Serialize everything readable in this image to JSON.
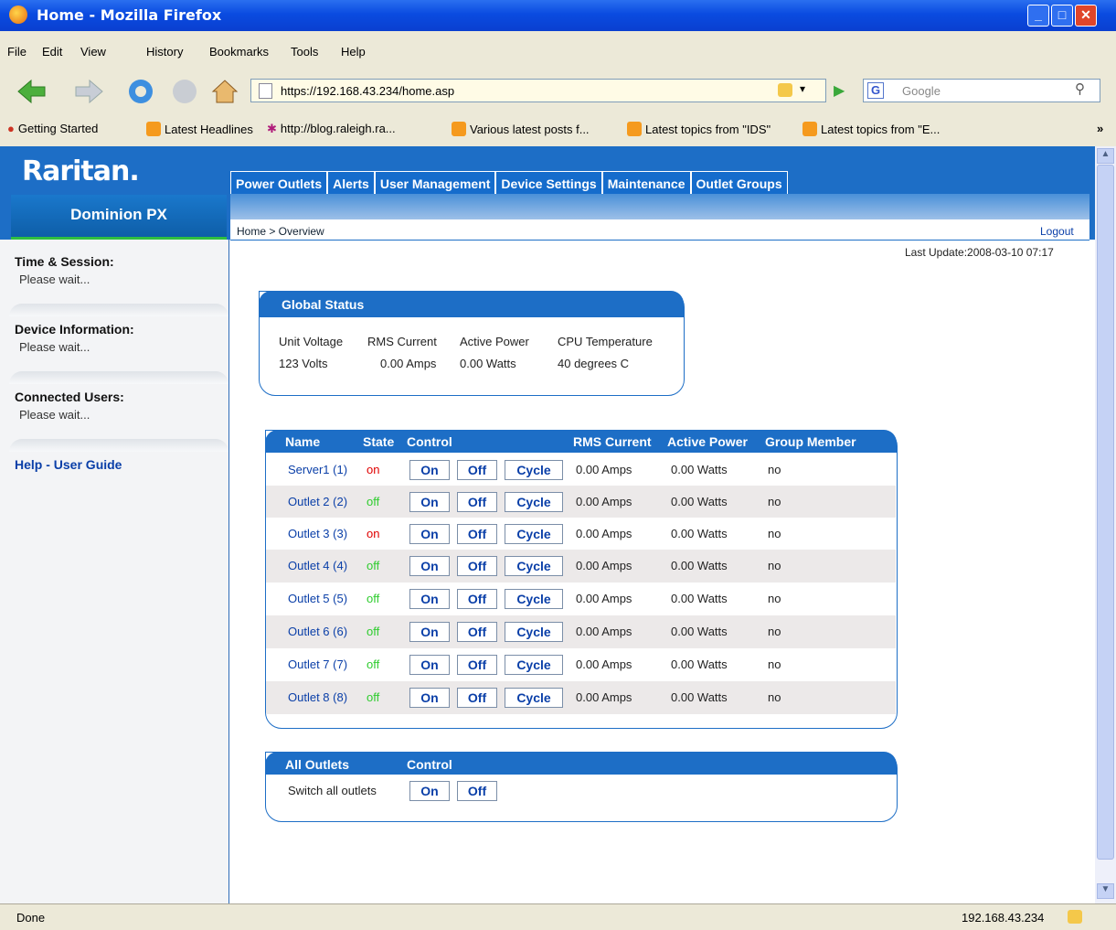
{
  "window": {
    "title": "Home - Mozilla Firefox"
  },
  "menu": [
    "File",
    "Edit",
    "View",
    "History",
    "Bookmarks",
    "Tools",
    "Help"
  ],
  "nav": {
    "url": "https://192.168.43.234/home.asp",
    "search_placeholder": "Google"
  },
  "bookmarks": [
    "Getting Started",
    "Latest Headlines",
    "http://blog.raleigh.ra...",
    "Various latest posts f...",
    "Latest topics from \"IDS\"",
    "Latest topics from \"E..."
  ],
  "header": {
    "logo": "Raritan.",
    "product": "Dominion PX",
    "tabs": [
      "Power Outlets",
      "Alerts",
      "User Management",
      "Device Settings",
      "Maintenance",
      "Outlet Groups"
    ],
    "breadcrumb": "Home > Overview",
    "logout": "Logout",
    "last_update": "Last Update:2008-03-10 07:17"
  },
  "sidebar": {
    "sections": [
      {
        "title": "Time & Session:",
        "value": "Please wait..."
      },
      {
        "title": "Device Information:",
        "value": "Please wait..."
      },
      {
        "title": "Connected Users:",
        "value": "Please wait..."
      }
    ],
    "help": "Help - User Guide"
  },
  "global_status": {
    "title": "Global Status",
    "labels": [
      "Unit Voltage",
      "RMS Current",
      "Active Power",
      "CPU Temperature"
    ],
    "values": [
      "123 Volts",
      "0.00 Amps",
      "0.00 Watts",
      "40 degrees C"
    ]
  },
  "outlets": {
    "headers": {
      "name": "Name",
      "state": "State",
      "control": "Control",
      "rms": "RMS Current",
      "power": "Active Power",
      "group": "Group Member"
    },
    "buttons": {
      "on": "On",
      "off": "Off",
      "cycle": "Cycle"
    },
    "rows": [
      {
        "name": "Server1 (1)",
        "state": "on",
        "rms": "0.00 Amps",
        "power": "0.00 Watts",
        "group": "no"
      },
      {
        "name": "Outlet 2 (2)",
        "state": "off",
        "rms": "0.00 Amps",
        "power": "0.00 Watts",
        "group": "no"
      },
      {
        "name": "Outlet 3 (3)",
        "state": "on",
        "rms": "0.00 Amps",
        "power": "0.00 Watts",
        "group": "no"
      },
      {
        "name": "Outlet 4 (4)",
        "state": "off",
        "rms": "0.00 Amps",
        "power": "0.00 Watts",
        "group": "no"
      },
      {
        "name": "Outlet 5 (5)",
        "state": "off",
        "rms": "0.00 Amps",
        "power": "0.00 Watts",
        "group": "no"
      },
      {
        "name": "Outlet 6 (6)",
        "state": "off",
        "rms": "0.00 Amps",
        "power": "0.00 Watts",
        "group": "no"
      },
      {
        "name": "Outlet 7 (7)",
        "state": "off",
        "rms": "0.00 Amps",
        "power": "0.00 Watts",
        "group": "no"
      },
      {
        "name": "Outlet 8 (8)",
        "state": "off",
        "rms": "0.00 Amps",
        "power": "0.00 Watts",
        "group": "no"
      }
    ]
  },
  "all_outlets": {
    "title": "All Outlets",
    "control_label": "Control",
    "row_label": "Switch all outlets",
    "on": "On",
    "off": "Off"
  },
  "statusbar": {
    "left": "Done",
    "right": "192.168.43.234"
  },
  "colors": {
    "brand_blue": "#1d6ec6",
    "state_on": "#e00000",
    "state_off": "#2ecc2e"
  }
}
